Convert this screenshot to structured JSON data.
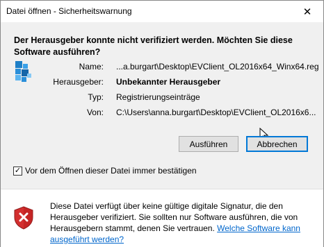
{
  "window": {
    "title": "Datei öffnen - Sicherheitswarnung",
    "close_glyph": "✕"
  },
  "heading": "Der Herausgeber konnte nicht verifiziert werden. Möchten Sie diese Software ausführen?",
  "file_icon": "registry-file-icon",
  "details": [
    {
      "label": "Name:",
      "value": "...a.burgart\\Desktop\\EVClient_OL2016x64_Winx64.reg",
      "bold": false
    },
    {
      "label": "Herausgeber:",
      "value": "Unbekannter Herausgeber",
      "bold": true
    },
    {
      "label": "Typ:",
      "value": "Registrierungseinträge",
      "bold": false
    },
    {
      "label": "Von:",
      "value": "C:\\Users\\anna.burgart\\Desktop\\EVClient_OL2016x6...",
      "bold": false
    }
  ],
  "buttons": {
    "run": "Ausführen",
    "cancel": "Abbrechen"
  },
  "checkbox": {
    "label": "Vor dem Öffnen dieser Datei immer bestätigen",
    "checked": true,
    "check_glyph": "✓"
  },
  "footer": {
    "text": "Diese Datei verfügt über keine gültige digitale Signatur, die den Herausgeber verifiziert. Sie sollten nur Software ausführen, die von Herausgebern stammt, denen Sie vertrauen. ",
    "link": "Welche Software kann ausgeführt werden?",
    "icon": "shield-error-icon"
  },
  "colors": {
    "accent": "#0078d7",
    "link": "#0066cc",
    "shield_red": "#d32f2f"
  }
}
